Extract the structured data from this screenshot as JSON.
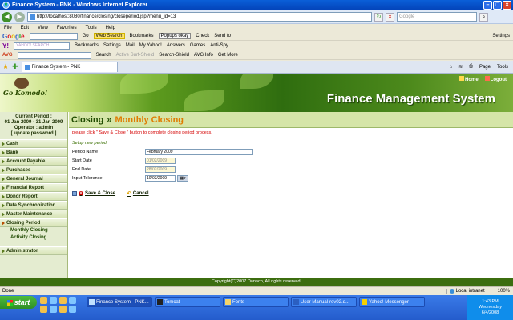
{
  "window": {
    "title": "Finance System - PNK - Windows Internet Explorer"
  },
  "address_bar": {
    "url": "http://localhost:8080/finance/closing/closeperiod.jsp?menu_id=13",
    "search_placeholder": "Google"
  },
  "menu_bar": [
    "File",
    "Edit",
    "View",
    "Favorites",
    "Tools",
    "Help"
  ],
  "toolbar_google": {
    "logo": "Google",
    "items": [
      "Go",
      "Web Search",
      "Bookmarks",
      "Popups okay",
      "Check",
      "Send to"
    ],
    "settings": "Settings"
  },
  "toolbar_yahoo": {
    "logo": "Y!",
    "search_label": "YAHOO! SEARCH",
    "items": [
      "Bookmarks",
      "Settings",
      "Mail",
      "My Yahoo!",
      "Answers",
      "Games",
      "Anti-Spy"
    ]
  },
  "toolbar_avg": {
    "logo": "AVG",
    "items": [
      "Search",
      "Active Surf-Shield",
      "Search-Shield",
      "AVG Info",
      "Get More"
    ]
  },
  "tab": {
    "label": "Finance System - PNK"
  },
  "ie_tools": [
    "Page",
    "Tools"
  ],
  "header": {
    "logo_text": "Go Komodo!",
    "title": "Finance Management System",
    "home_link": "Home",
    "logout_link": "Logout"
  },
  "period": {
    "label": "Current Period :",
    "range": "01 Jan 2009 - 31 Jan 2009",
    "operator": "Operator : admin",
    "update_link": "[ update password ]"
  },
  "sidebar": {
    "items": [
      "Cash",
      "Bank",
      "Account Payable",
      "Purchases",
      "General Journal",
      "Financial Report",
      "Donor Report",
      "Data Synchronization",
      "Master Maintenance",
      "Closing Period",
      "Administrator"
    ],
    "closing_sub": [
      "Monthly Closing",
      "Activity Closing"
    ]
  },
  "page": {
    "breadcrumb_parent": "Closing",
    "breadcrumb_sep": "»",
    "breadcrumb_current": "Monthly Closing",
    "instruction": "please click \" Save & Close \" button to complete closing period process.",
    "section_title": "Setup new period",
    "fields": {
      "period_name": {
        "label": "Period Name",
        "value": "February 2009"
      },
      "start_date": {
        "label": "Start Date",
        "value": "01/02/2009"
      },
      "end_date": {
        "label": "End Date",
        "value": "28/02/2009"
      },
      "input_tolerance": {
        "label": "Input Tolerance",
        "value": "10/03/2009"
      }
    },
    "save_label": "Save & Close",
    "cancel_label": "Cancel"
  },
  "footer": {
    "text": "Copyright(C)2007 Danaco, All rights reserved."
  },
  "status_bar": {
    "left": "Done",
    "zone": "Local intranet",
    "zoom": "100%"
  },
  "taskbar": {
    "start": "start",
    "tasks": [
      "Finance System - PNK...",
      "Tomcat",
      "Fonts",
      "User Manual-rev02.d...",
      "Yahoo! Messenger"
    ],
    "time": "1:43 PM",
    "day": "Wednesday",
    "date": "6/4/2008"
  }
}
